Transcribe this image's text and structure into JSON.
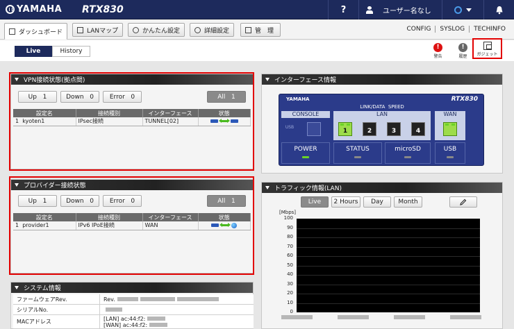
{
  "header": {
    "brand": "YAMAHA",
    "model": "RTX830",
    "help_label": "?",
    "user_label": "ユーザー名なし",
    "bell_icon": "bell-icon"
  },
  "nav": {
    "buttons": [
      {
        "label": "ダッシュボード",
        "icon": "dashboard-icon"
      },
      {
        "label": "LANマップ",
        "icon": "lanmap-icon"
      },
      {
        "label": "かんたん設定",
        "icon": "wizard-icon"
      },
      {
        "label": "詳細設定",
        "icon": "gear-icon"
      },
      {
        "label": "管　理",
        "icon": "wrench-icon"
      }
    ],
    "links": [
      "CONFIG",
      "SYSLOG",
      "TECHINFO"
    ]
  },
  "tabs": {
    "live": "Live",
    "history": "History"
  },
  "alerts": {
    "warning_label": "警告",
    "history_label": "履歴",
    "gadget_label": "ガジェット"
  },
  "vpn_panel": {
    "title": "VPN接続状態(拠点間)",
    "filters": [
      {
        "name": "Up",
        "count": "1"
      },
      {
        "name": "Down",
        "count": "0"
      },
      {
        "name": "Error",
        "count": "0"
      }
    ],
    "all_label": "All",
    "all_count": "1",
    "columns": [
      "設定名",
      "接続種別",
      "インターフェース",
      "状態"
    ],
    "rows": [
      {
        "num": "1",
        "name": "kyoten1",
        "type": "IPsec接続",
        "iface": "TUNNEL[02]"
      }
    ]
  },
  "provider_panel": {
    "title": "プロバイダー接続状態",
    "filters": [
      {
        "name": "Up",
        "count": "1"
      },
      {
        "name": "Down",
        "count": "0"
      },
      {
        "name": "Error",
        "count": "0"
      }
    ],
    "all_label": "All",
    "all_count": "1",
    "columns": [
      "設定名",
      "接続種別",
      "インターフェース",
      "状態"
    ],
    "rows": [
      {
        "num": "1",
        "name": "provider1",
        "type": "IPv6 IPoE接続",
        "iface": "WAN"
      }
    ]
  },
  "system_panel": {
    "title": "システム情報",
    "rows": [
      {
        "key": "ファームウェアRev.",
        "value": "Rev."
      },
      {
        "key": "シリアルNo.",
        "value": ""
      },
      {
        "key": "MACアドレス",
        "value": "[LAN] ac:44:f2:",
        "value2": "[WAN] ac:44:f2:"
      }
    ]
  },
  "iface_panel": {
    "title": "インターフェース情報",
    "router_brand": "YAMAHA",
    "router_model": "RTX830",
    "console_label": "CONSOLE",
    "usb_small": "USB",
    "link_data": "LINK/DATA",
    "speed": "SPEED",
    "lan_label": "LAN",
    "wan_label": "WAN",
    "lan_ports": [
      "1",
      "2",
      "3",
      "4"
    ],
    "statuses": [
      "POWER",
      "STATUS",
      "microSD",
      "USB"
    ]
  },
  "traffic_panel": {
    "title": "トラフィック情報(LAN)",
    "ranges": [
      "Live",
      "2 Hours",
      "Day",
      "Month"
    ],
    "edit_icon": "pencil-icon",
    "unit": "[Mbps]",
    "yticks": [
      "100",
      "90",
      "80",
      "70",
      "60",
      "50",
      "40",
      "30",
      "20",
      "10",
      "0"
    ]
  }
}
